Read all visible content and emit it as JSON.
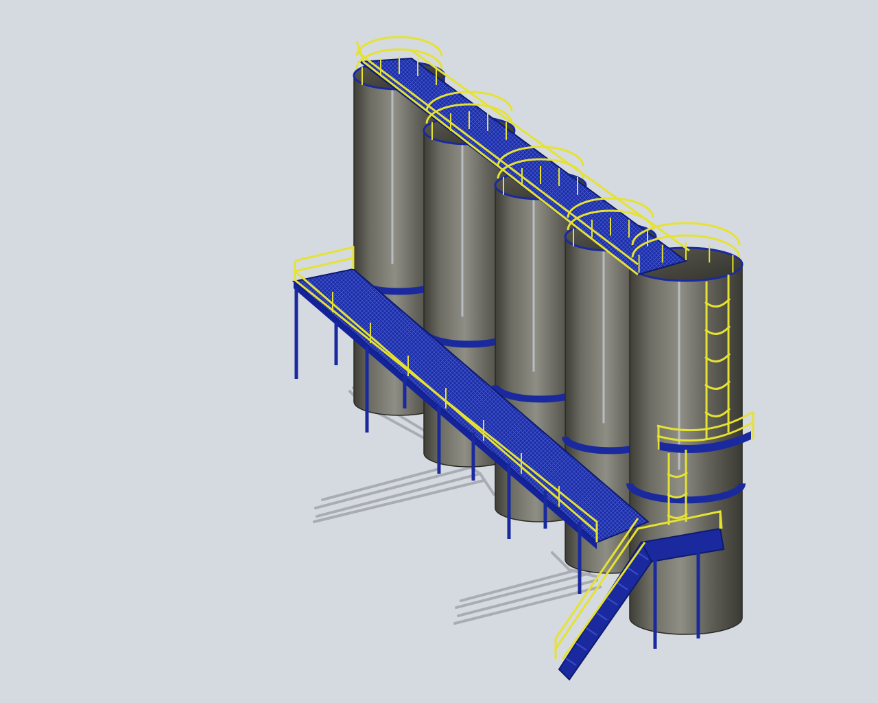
{
  "scene": {
    "colors": {
      "background": "#d5dae0",
      "silo_body_dark": "#4a4a42",
      "silo_body_light": "#8d8d84",
      "steel_frame": "#1a2a9e",
      "steel_frame_dark": "#0d1a6e",
      "handrail": "#e6e232",
      "pipe": "#a9adb3"
    },
    "components": {
      "silo_count": 5,
      "has_cage_ladder": true,
      "has_access_stair": true,
      "has_intermediate_platform": true,
      "has_discharge_pipes": true
    }
  }
}
